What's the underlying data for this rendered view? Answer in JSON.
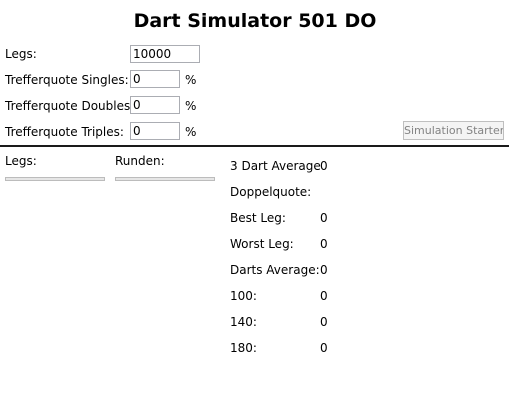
{
  "app": {
    "title": "Dart Simulator 501 DO"
  },
  "form": {
    "legs_label": "Legs:",
    "legs_value": "10000",
    "singles_label": "Trefferquote Singles:",
    "singles_value": "0",
    "singles_unit": "%",
    "doubles_label": "Trefferquote Doubles:",
    "doubles_value": "0",
    "doubles_unit": "%",
    "triples_label": "Trefferquote Triples:",
    "triples_value": "0",
    "triples_unit": "%",
    "start_button": "Simulation Starten",
    "start_button_enabled": false
  },
  "progress": {
    "legs_label": "Legs:",
    "legs_progress": 0,
    "rounds_label": "Runden:",
    "rounds_progress": 0
  },
  "stats": {
    "three_dart_average_label": "3 Dart Average",
    "three_dart_average_value": "0",
    "double_rate_label": "Doppelquote:",
    "double_rate_value": "",
    "best_leg_label": "Best Leg:",
    "best_leg_value": "0",
    "worst_leg_label": "Worst Leg:",
    "worst_leg_value": "0",
    "darts_average_label": "Darts Average:",
    "darts_average_value": "0",
    "score_100_label": "100:",
    "score_100_value": "0",
    "score_140_label": "140:",
    "score_140_value": "0",
    "score_180_label": "180:",
    "score_180_value": "0"
  },
  "colors": {
    "divider": "#1a1a1a",
    "input_border": "#abadb3",
    "button_disabled_text": "#838383",
    "progress_fill": "#06b025"
  }
}
